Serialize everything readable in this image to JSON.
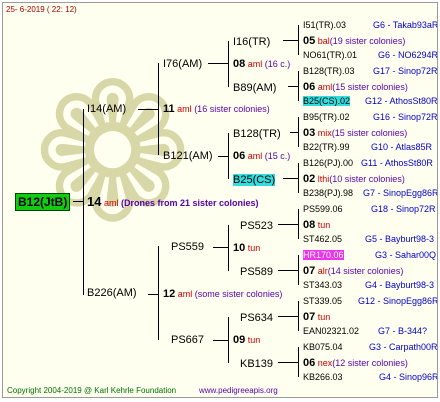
{
  "header_date": "25-  6-2019 (  22: 12)",
  "footer": {
    "copyright": "Copyright 2004-2019 @ Karl Kehrle Foundation",
    "site": "www.pedigreeapis.org"
  },
  "root": "B12(JtB)",
  "gen1": [
    {
      "label": "I14(AM)",
      "num": "14",
      "tag": "aml",
      "note": "(Drones from 21 sister colonies)"
    },
    {
      "label": "B226(AM)",
      "num": "12",
      "tag": "aml",
      "note": "(some sister colonies)"
    }
  ],
  "gen2": [
    {
      "label": "I76(AM)",
      "num": "11",
      "tag": "aml",
      "note": "(16 sister colonies)"
    },
    {
      "label": "B121(AM)",
      "num": "06",
      "tag": "aml",
      "note": "(15 c.)"
    },
    {
      "label": "PS559",
      "num": "10",
      "tag": "tun"
    },
    {
      "label": "PS667",
      "num": "09",
      "tun": "tun",
      "tag": "tun"
    }
  ],
  "gen3": [
    {
      "label": "I16(TR)",
      "num": "08",
      "tag": "aml",
      "note": "(16 c.)"
    },
    {
      "label": "B89(AM)"
    },
    {
      "label": "B128(TR)",
      "num": "06",
      "tag": "aml",
      "note": "(15 c.)"
    },
    {
      "label": "B25(CS)"
    },
    {
      "label": "PS523",
      "num": "08",
      "tag": "tun"
    },
    {
      "label": "PS589"
    },
    {
      "label": "PS634",
      "num": "07",
      "tag": "tun"
    },
    {
      "label": "KB139"
    }
  ],
  "gen4": [
    {
      "left": "I51(TR).03",
      "right": "G6 - Takab93aR"
    },
    {
      "num": "05",
      "tag": "bal",
      "note": "(19 sister colonies)"
    },
    {
      "left": "NO61(TR).01",
      "right": "G6 - NO6294R"
    },
    {
      "left": "B128(TR).03",
      "right": "G17 - Sinop72R"
    },
    {
      "num": "06",
      "tag": "aml",
      "note": "(15 sister colonies)"
    },
    {
      "left": "B25(CS).02",
      "right": "G12 - AthosSt80R"
    },
    {
      "left": "B95(TR).02",
      "right": "G16 - Sinop72R"
    },
    {
      "num": "03",
      "tag": "mix",
      "note": "(15 sister colonies)"
    },
    {
      "left": "B22(TR).99",
      "right": "G10 - Atlas85R"
    },
    {
      "left": "B126(PJ).00",
      "right": "G11 - AthosSt80R"
    },
    {
      "num": "02",
      "tag": "lthi",
      "note": "(10 sister colonies)"
    },
    {
      "left": "B238(PJ).98",
      "right": "G7 - SinopEgg86R"
    },
    {
      "left": "PS599.06",
      "right": "G18 - Sinop72R"
    },
    {
      "num": "08",
      "tag": "tun"
    },
    {
      "left": "ST462.05",
      "right": "G5 - Bayburt98-3"
    },
    {
      "left": "HR170.06",
      "right": "G3 - Sahar00Q"
    },
    {
      "num": "07",
      "tag": "alr",
      "note": "(14 sister colonies)"
    },
    {
      "left": "ST343.03",
      "right": "G4 - Bayburt98-3"
    },
    {
      "left": "ST339.05",
      "right": "G12 - SinopEgg86R"
    },
    {
      "num": "07",
      "tag": "tun"
    },
    {
      "left": "EAN02321.02",
      "right": "G7 - B-344?"
    },
    {
      "left": "KB075.04",
      "right": "G3 - Carpath00R"
    },
    {
      "num": "06",
      "tag": "nex",
      "note": "(12 sister colonies)"
    },
    {
      "left": "KB266.03",
      "right": "G4 - Sinop96R"
    }
  ],
  "colors": {
    "root_bg": "#11cc11",
    "cyan_hl": "#33dddd",
    "magenta_hl": "#ee33ee",
    "line": "#000000"
  }
}
